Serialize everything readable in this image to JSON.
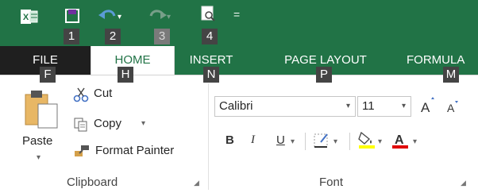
{
  "quick_access": {
    "items": [
      {
        "name": "excel-logo",
        "keytip": ""
      },
      {
        "name": "save",
        "keytip": "1"
      },
      {
        "name": "undo",
        "keytip": "2"
      },
      {
        "name": "redo",
        "keytip": "3"
      },
      {
        "name": "print-preview",
        "keytip": "4"
      }
    ],
    "customize_glyph": "="
  },
  "tabs": [
    {
      "label": "FILE",
      "keytip": "F"
    },
    {
      "label": "HOME",
      "keytip": "H"
    },
    {
      "label": "INSERT",
      "keytip": "N"
    },
    {
      "label": "PAGE LAYOUT",
      "keytip": "P"
    },
    {
      "label": "FORMULA",
      "keytip": "M"
    }
  ],
  "clipboard": {
    "paste_label": "Paste",
    "cut_label": "Cut",
    "copy_label": "Copy",
    "format_painter_label": "Format Painter",
    "group_label": "Clipboard"
  },
  "font": {
    "font_name": "Calibri",
    "font_size": "11",
    "bold": "B",
    "italic": "I",
    "underline": "U",
    "group_label": "Font"
  },
  "colors": {
    "excel_green": "#217346",
    "file_tab": "#1f1f1f",
    "highlight_yellow": "#ffff00",
    "font_red": "#e00000"
  }
}
